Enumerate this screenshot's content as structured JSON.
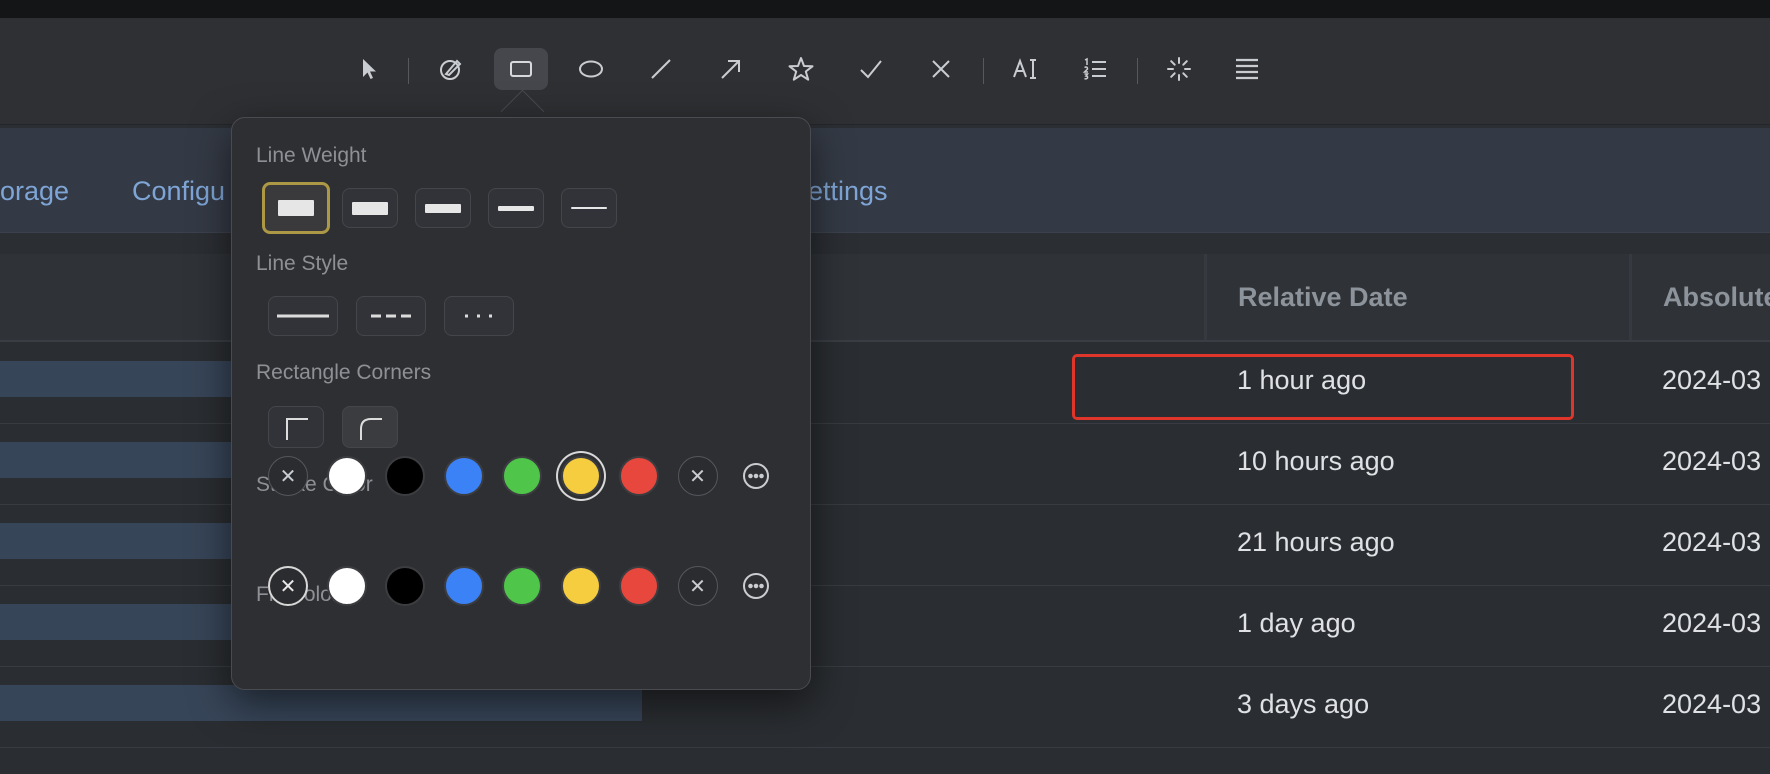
{
  "toolbar": {
    "tools": [
      {
        "name": "select-arrow-icon"
      },
      {
        "name": "highlighter-icon"
      },
      {
        "name": "rectangle-icon",
        "selected": true
      },
      {
        "name": "ellipse-icon"
      },
      {
        "name": "line-icon"
      },
      {
        "name": "arrow-icon"
      },
      {
        "name": "star-icon"
      },
      {
        "name": "checkmark-icon"
      },
      {
        "name": "x-mark-icon"
      },
      {
        "name": "text-icon"
      },
      {
        "name": "numbered-list-icon"
      },
      {
        "name": "loading-spinner-icon"
      },
      {
        "name": "menu-lines-icon"
      }
    ]
  },
  "nav": {
    "links": [
      "orage",
      "Configu",
      "ettings"
    ]
  },
  "table": {
    "headers": {
      "relative": "Relative Date",
      "absolute": "Absolute"
    },
    "rows": [
      {
        "relative": "1 hour ago",
        "absolute": "2024-03"
      },
      {
        "relative": "10 hours ago",
        "absolute": "2024-03"
      },
      {
        "relative": "21 hours ago",
        "absolute": "2024-03"
      },
      {
        "relative": "1 day ago",
        "absolute": "2024-03"
      },
      {
        "relative": "3 days ago",
        "absolute": "2024-03"
      }
    ]
  },
  "popover": {
    "line_weight_label": "Line Weight",
    "line_style_label": "Line Style",
    "corners_label": "Rectangle Corners",
    "stroke_label": "Stroke Color",
    "fill_label": "Fill Color",
    "line_weights_selected": 0,
    "stroke_colors": [
      "none",
      "#ffffff",
      "#000000",
      "#3b82f6",
      "#4fc64a",
      "#f5cd3f",
      "#e7473c",
      "clear",
      "more"
    ],
    "stroke_selected": 5,
    "fill_colors": [
      "none",
      "#ffffff",
      "#000000",
      "#3b82f6",
      "#4fc64a",
      "#f5cd3f",
      "#e7473c",
      "clear",
      "more"
    ],
    "fill_selected": 0,
    "accent_color": "#ac9845",
    "highlight_color": "#e0352b"
  }
}
